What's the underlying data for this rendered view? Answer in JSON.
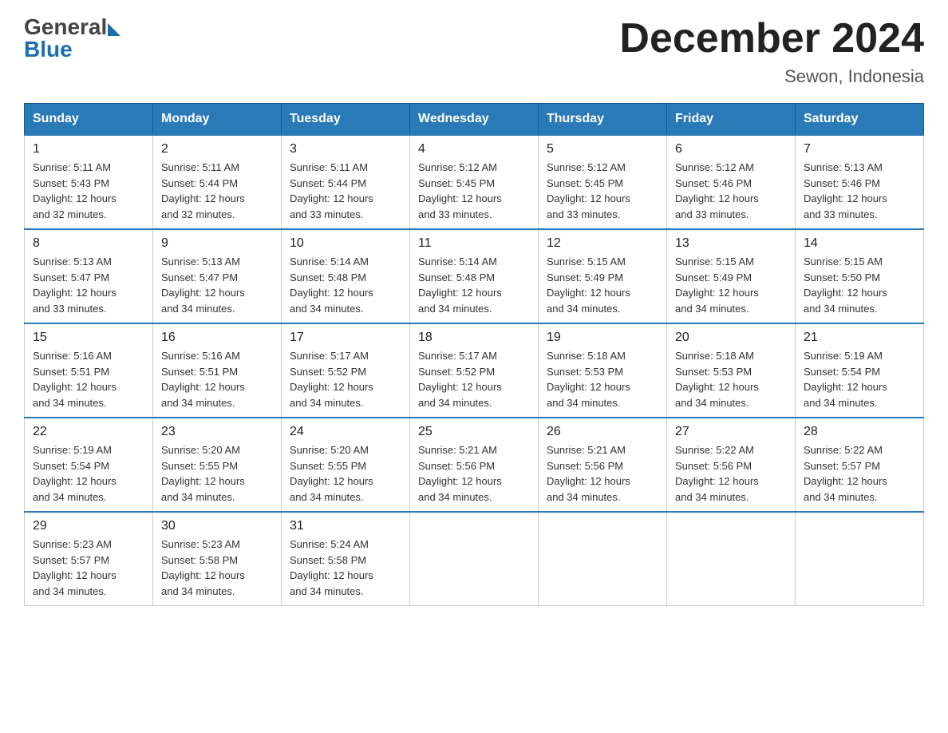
{
  "header": {
    "title": "December 2024",
    "subtitle": "Sewon, Indonesia",
    "logo_general": "General",
    "logo_blue": "Blue"
  },
  "days_of_week": [
    "Sunday",
    "Monday",
    "Tuesday",
    "Wednesday",
    "Thursday",
    "Friday",
    "Saturday"
  ],
  "weeks": [
    [
      {
        "day": "1",
        "sunrise": "5:11 AM",
        "sunset": "5:43 PM",
        "daylight": "12 hours and 32 minutes."
      },
      {
        "day": "2",
        "sunrise": "5:11 AM",
        "sunset": "5:44 PM",
        "daylight": "12 hours and 32 minutes."
      },
      {
        "day": "3",
        "sunrise": "5:11 AM",
        "sunset": "5:44 PM",
        "daylight": "12 hours and 33 minutes."
      },
      {
        "day": "4",
        "sunrise": "5:12 AM",
        "sunset": "5:45 PM",
        "daylight": "12 hours and 33 minutes."
      },
      {
        "day": "5",
        "sunrise": "5:12 AM",
        "sunset": "5:45 PM",
        "daylight": "12 hours and 33 minutes."
      },
      {
        "day": "6",
        "sunrise": "5:12 AM",
        "sunset": "5:46 PM",
        "daylight": "12 hours and 33 minutes."
      },
      {
        "day": "7",
        "sunrise": "5:13 AM",
        "sunset": "5:46 PM",
        "daylight": "12 hours and 33 minutes."
      }
    ],
    [
      {
        "day": "8",
        "sunrise": "5:13 AM",
        "sunset": "5:47 PM",
        "daylight": "12 hours and 33 minutes."
      },
      {
        "day": "9",
        "sunrise": "5:13 AM",
        "sunset": "5:47 PM",
        "daylight": "12 hours and 34 minutes."
      },
      {
        "day": "10",
        "sunrise": "5:14 AM",
        "sunset": "5:48 PM",
        "daylight": "12 hours and 34 minutes."
      },
      {
        "day": "11",
        "sunrise": "5:14 AM",
        "sunset": "5:48 PM",
        "daylight": "12 hours and 34 minutes."
      },
      {
        "day": "12",
        "sunrise": "5:15 AM",
        "sunset": "5:49 PM",
        "daylight": "12 hours and 34 minutes."
      },
      {
        "day": "13",
        "sunrise": "5:15 AM",
        "sunset": "5:49 PM",
        "daylight": "12 hours and 34 minutes."
      },
      {
        "day": "14",
        "sunrise": "5:15 AM",
        "sunset": "5:50 PM",
        "daylight": "12 hours and 34 minutes."
      }
    ],
    [
      {
        "day": "15",
        "sunrise": "5:16 AM",
        "sunset": "5:51 PM",
        "daylight": "12 hours and 34 minutes."
      },
      {
        "day": "16",
        "sunrise": "5:16 AM",
        "sunset": "5:51 PM",
        "daylight": "12 hours and 34 minutes."
      },
      {
        "day": "17",
        "sunrise": "5:17 AM",
        "sunset": "5:52 PM",
        "daylight": "12 hours and 34 minutes."
      },
      {
        "day": "18",
        "sunrise": "5:17 AM",
        "sunset": "5:52 PM",
        "daylight": "12 hours and 34 minutes."
      },
      {
        "day": "19",
        "sunrise": "5:18 AM",
        "sunset": "5:53 PM",
        "daylight": "12 hours and 34 minutes."
      },
      {
        "day": "20",
        "sunrise": "5:18 AM",
        "sunset": "5:53 PM",
        "daylight": "12 hours and 34 minutes."
      },
      {
        "day": "21",
        "sunrise": "5:19 AM",
        "sunset": "5:54 PM",
        "daylight": "12 hours and 34 minutes."
      }
    ],
    [
      {
        "day": "22",
        "sunrise": "5:19 AM",
        "sunset": "5:54 PM",
        "daylight": "12 hours and 34 minutes."
      },
      {
        "day": "23",
        "sunrise": "5:20 AM",
        "sunset": "5:55 PM",
        "daylight": "12 hours and 34 minutes."
      },
      {
        "day": "24",
        "sunrise": "5:20 AM",
        "sunset": "5:55 PM",
        "daylight": "12 hours and 34 minutes."
      },
      {
        "day": "25",
        "sunrise": "5:21 AM",
        "sunset": "5:56 PM",
        "daylight": "12 hours and 34 minutes."
      },
      {
        "day": "26",
        "sunrise": "5:21 AM",
        "sunset": "5:56 PM",
        "daylight": "12 hours and 34 minutes."
      },
      {
        "day": "27",
        "sunrise": "5:22 AM",
        "sunset": "5:56 PM",
        "daylight": "12 hours and 34 minutes."
      },
      {
        "day": "28",
        "sunrise": "5:22 AM",
        "sunset": "5:57 PM",
        "daylight": "12 hours and 34 minutes."
      }
    ],
    [
      {
        "day": "29",
        "sunrise": "5:23 AM",
        "sunset": "5:57 PM",
        "daylight": "12 hours and 34 minutes."
      },
      {
        "day": "30",
        "sunrise": "5:23 AM",
        "sunset": "5:58 PM",
        "daylight": "12 hours and 34 minutes."
      },
      {
        "day": "31",
        "sunrise": "5:24 AM",
        "sunset": "5:58 PM",
        "daylight": "12 hours and 34 minutes."
      },
      null,
      null,
      null,
      null
    ]
  ],
  "labels": {
    "sunrise": "Sunrise:",
    "sunset": "Sunset:",
    "daylight": "Daylight:"
  }
}
